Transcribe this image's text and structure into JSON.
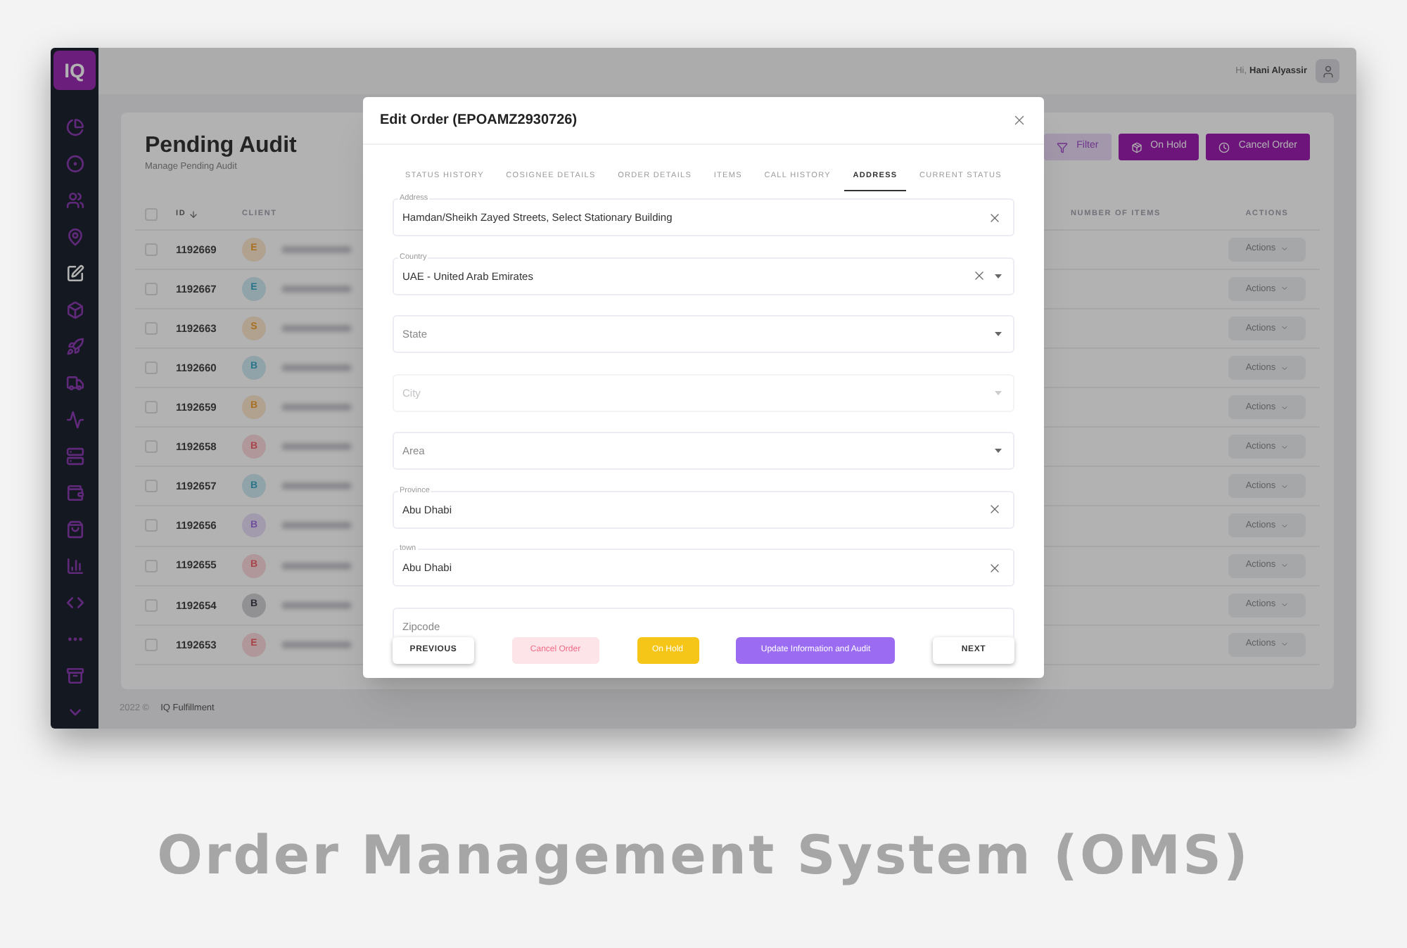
{
  "sidebar": {
    "logo": "IQ",
    "items": [
      {
        "selected": false
      },
      {
        "selected": false
      },
      {
        "selected": false
      },
      {
        "selected": false
      },
      {
        "selected": true
      },
      {
        "selected": false
      },
      {
        "selected": false
      },
      {
        "selected": false
      },
      {
        "selected": false
      },
      {
        "selected": false
      },
      {
        "selected": false
      },
      {
        "selected": false
      },
      {
        "selected": false
      },
      {
        "selected": false
      },
      {
        "selected": false
      },
      {
        "selected": false
      },
      {
        "selected": false
      }
    ]
  },
  "topbar": {
    "greeting": "Hi,",
    "user": "Hani Alyassir"
  },
  "page": {
    "title": "Pending Audit",
    "subtitle": "Manage Pending Audit",
    "buttons": [
      {
        "label": "Filter",
        "kind": "filter"
      },
      {
        "label": "On Hold",
        "kind": "hold"
      },
      {
        "label": "Cancel Order",
        "kind": "cancel"
      }
    ]
  },
  "table": {
    "columns": [
      {
        "label": "ID",
        "sorted": true
      },
      {
        "label": "CLIENT",
        "sorted": false
      },
      {
        "label": "NUMBER OF ITEMS",
        "sorted": false
      },
      {
        "label": "ACTIONS",
        "sorted": false
      }
    ],
    "select_all": {
      "checked": false
    },
    "rows": [
      {
        "checked": false,
        "id": "1192669",
        "initial": "E",
        "color": "#a87022",
        "action": "Actions"
      },
      {
        "checked": false,
        "id": "1192667",
        "initial": "E",
        "color": "#297589",
        "action": "Actions"
      },
      {
        "checked": false,
        "id": "1192663",
        "initial": "S",
        "color": "#a87022",
        "action": "Actions"
      },
      {
        "checked": false,
        "id": "1192660",
        "initial": "B",
        "color": "#297589",
        "action": "Actions"
      },
      {
        "checked": false,
        "id": "1192659",
        "initial": "B",
        "color": "#a87022",
        "action": "Actions"
      },
      {
        "checked": false,
        "id": "1192658",
        "initial": "B",
        "color": "#a8434a",
        "action": "Actions"
      },
      {
        "checked": false,
        "id": "1192657",
        "initial": "B",
        "color": "#297589",
        "action": "Actions"
      },
      {
        "checked": false,
        "id": "1192656",
        "initial": "B",
        "color": "#704e9d",
        "action": "Actions"
      },
      {
        "checked": false,
        "id": "1192655",
        "initial": "B",
        "color": "#a8434a",
        "action": "Actions"
      },
      {
        "checked": false,
        "id": "1192654",
        "initial": "B",
        "color": "#2a2a35",
        "action": "Actions"
      },
      {
        "checked": false,
        "id": "1192653",
        "initial": "E",
        "color": "#a8434a",
        "action": "Actions"
      }
    ]
  },
  "footer": {
    "year": "2022 ©",
    "company": "IQ Fulfillment"
  },
  "modal": {
    "title": "Edit Order (EPOAMZ2930726)",
    "tabs": [
      {
        "label": "STATUS HISTORY",
        "selected": false
      },
      {
        "label": "COSIGNEE DETAILS",
        "selected": false
      },
      {
        "label": "ORDER DETAILS",
        "selected": false
      },
      {
        "label": "ITEMS",
        "selected": false
      },
      {
        "label": "CALL HISTORY",
        "selected": false
      },
      {
        "label": "ADDRESS",
        "selected": true
      },
      {
        "label": "CURRENT STATUS",
        "selected": false
      }
    ],
    "fields": [
      {
        "label": "Address",
        "value": "Hamdan/Sheikh Zayed Streets, Select Stationary Building",
        "clearable": true,
        "dropdown": false,
        "disabled": false
      },
      {
        "label": "Country",
        "value": "UAE - United Arab Emirates",
        "clearable": true,
        "dropdown": true,
        "disabled": false
      },
      {
        "placeholder": "State",
        "clearable": false,
        "dropdown": true,
        "disabled": false
      },
      {
        "placeholder": "City",
        "clearable": false,
        "dropdown": true,
        "disabled": true
      },
      {
        "placeholder": "Area",
        "clearable": false,
        "dropdown": true,
        "disabled": false
      },
      {
        "label": "Province",
        "value": "Abu Dhabi",
        "clearable": true,
        "dropdown": false,
        "disabled": false
      },
      {
        "label": "town",
        "value": "Abu Dhabi",
        "clearable": true,
        "dropdown": false,
        "disabled": false
      },
      {
        "placeholder": "Zipcode",
        "clearable": false,
        "dropdown": false,
        "disabled": false
      }
    ],
    "buttons": [
      {
        "label": "PREVIOUS",
        "kind": "nav"
      },
      {
        "label": "Cancel Order",
        "kind": "cancel"
      },
      {
        "label": "On Hold",
        "kind": "hold"
      },
      {
        "label": "Update Information and Audit",
        "kind": "update"
      },
      {
        "label": "NEXT",
        "kind": "nav"
      }
    ]
  },
  "caption": "Order Management System (OMS)"
}
